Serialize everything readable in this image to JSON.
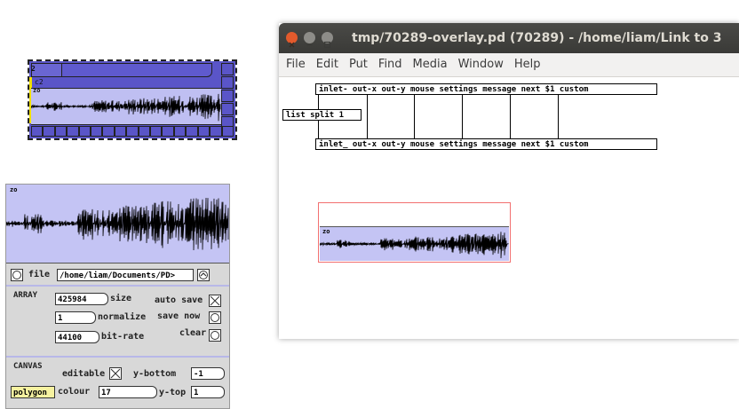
{
  "thumbnail": {
    "label_top": "2",
    "label_mid": "c2",
    "label_wave": "zo"
  },
  "props": {
    "wave_label": "zo",
    "file_label": "file",
    "file_path": "/home/liam/Documents/PD>",
    "array_header": "ARRAY",
    "size_value": "425984",
    "size_label": "size",
    "auto_save_label": "auto save",
    "normalize_value": "1",
    "normalize_label": "normalize",
    "save_now_label": "save now",
    "bitrate_value": "44100",
    "bitrate_label": "bit-rate",
    "clear_label": "clear",
    "canvas_header": "CANVAS",
    "editable_label": "editable",
    "y_bottom_label": "y-bottom",
    "y_bottom_value": "-1",
    "polygon_label": "polygon",
    "colour_label": "colour",
    "colour_value": "17",
    "y_top_label": "y-top",
    "y_top_value": "1"
  },
  "window": {
    "title": "tmp/70289-overlay.pd  (70289) - /home/liam/Link to 3",
    "menu": [
      "File",
      "Edit",
      "Put",
      "Find",
      "Media",
      "Window",
      "Help"
    ],
    "obj_top": "inlet- out-x out-y mouse settings message next $1 custom",
    "obj_split": "list split 1",
    "obj_bottom": "inlet_ out-x out-y mouse settings message next $1 custom",
    "graph_label": "zo"
  },
  "colors": {
    "array_fill": "#5a55c8",
    "wave_bg": "#c4c4f4",
    "close_btn": "#e35a2c",
    "titlebar": "#3c3b37"
  }
}
